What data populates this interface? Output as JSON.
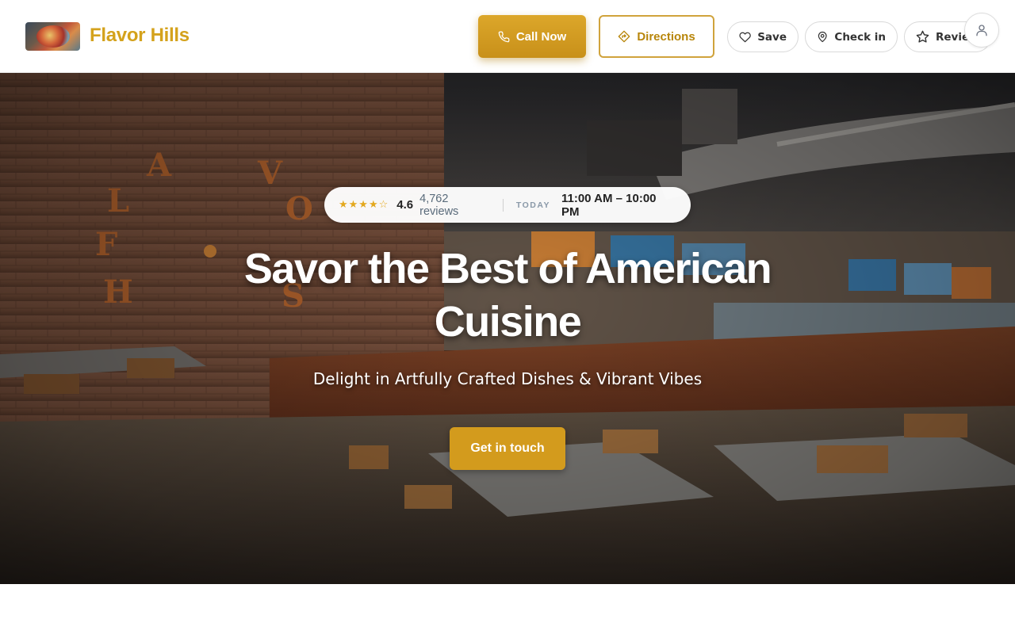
{
  "header": {
    "brand_name": "Flavor Hills",
    "call_label": "Call Now",
    "directions_label": "Directions",
    "save_label": "Save",
    "checkin_label": "Check in",
    "review_label": "Review"
  },
  "hero": {
    "stars": "★★★★☆",
    "rating": "4.6",
    "reviews": "4,762 reviews",
    "today_label": "TODAY",
    "hours": "11:00 AM – 10:00 PM",
    "title": "Savor the Best of American Cuisine",
    "subtitle": "Delight in Artfully Crafted Dishes & Vibrant Vibes",
    "cta_label": "Get in touch"
  },
  "colors": {
    "brand": "#d4a21c",
    "accent": "#d39b1d",
    "star": "#e3a81e"
  },
  "icons": [
    "phone-icon",
    "directions-icon",
    "heart-icon",
    "map-pin-icon",
    "star-icon",
    "user-icon"
  ]
}
